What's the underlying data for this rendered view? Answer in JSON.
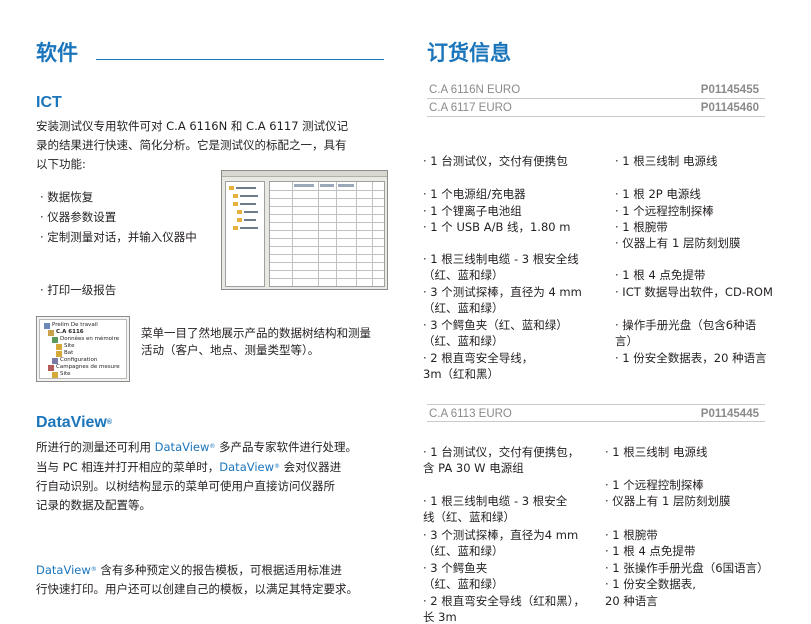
{
  "left": {
    "section_title": "软件",
    "ict_title": "ICT",
    "ict_para_lines": [
      "安装测试仪专用软件可对 C.A 6116N 和 C.A 6117 测试仪记",
      "录的结果进行快速、简化分析。它是测试仪的标配之一，具有",
      "以下功能:"
    ],
    "features": [
      "· 数据恢复",
      "· 仪器参数设置",
      "· 定制测量对话，并输入仪器中",
      "· 打印一级报告"
    ],
    "menu_caption_lines": [
      "菜单一目了然地展示产品的数据树结构和测量",
      "活动（客户、地点、测量类型等）。"
    ],
    "tree_items": [
      "Prelim De travail",
      "C.A 6116",
      "Données en mémoire",
      "Site",
      "Bat",
      "Configuration",
      "Campagnes de mesure",
      "Site"
    ],
    "dataview_title": "DataView",
    "dataview_mark": "®",
    "dv_para1": [
      {
        "pre": "所进行的测量还可利用 ",
        "dv": "DataView",
        "reg": "®",
        "post": " 多产品专家软件进行处理。"
      },
      {
        "pre": "当与 PC 相连并打开相应的菜单时，",
        "dv": "DataView",
        "reg": "®",
        "post": " 会对仪器进"
      },
      {
        "pre": "行自动识别。以树结构显示的菜单可使用户直接访问仪器所",
        "dv": "",
        "reg": "",
        "post": ""
      },
      {
        "pre": "记录的数据及配置等。",
        "dv": "",
        "reg": "",
        "post": ""
      }
    ],
    "dv_para2": [
      {
        "pre": "",
        "dv": "DataView",
        "reg": "®",
        "post": " 含有多种预定义的报告模板，可根据适用标准进"
      },
      {
        "pre": "行快速打印。用户还可以创建自己的模板，以满足其特定要求。",
        "dv": "",
        "reg": "",
        "post": ""
      }
    ]
  },
  "right": {
    "section_title": "订货信息",
    "orders_a": [
      {
        "name": "C.A 6116N EURO",
        "code": "P01145455"
      },
      {
        "name": "C.A 6117 EURO",
        "code": "P01145460"
      }
    ],
    "block_a_col1": [
      "· 1 台测试仪，交付有便携包",
      "· 1 个电源组/充电器",
      "· 1 个锂离子电池组",
      "· 1 个 USB A/B 线，1.80 m",
      "· 1 根三线制电缆 - 3 根安全线",
      "   （红、蓝和绿）",
      "· 3 个测试探棒，直径为 4 mm",
      "   （红、蓝和绿）",
      "· 3 个鳄鱼夹（红、蓝和绿）",
      "   （红、蓝和绿）",
      "· 2 根直弯安全导线，",
      "   3m（红和黑）"
    ],
    "block_a_col2": [
      "· 1 根三线制 电源线",
      "· 1 根 2P 电源线",
      "· 1 个远程控制探棒",
      "· 1 根腕带",
      "· 仪器上有 1 层防刻划膜",
      "· 1 根 4 点免提带",
      "· ICT 数据导出软件，CD-ROM",
      "· 操作手册光盘（包含6种语",
      "   言）",
      "· 1 份安全数据表，20 种语言"
    ],
    "orders_b": [
      {
        "name": "C.A 6113 EURO",
        "code": "P01145445"
      }
    ],
    "block_b_col1": [
      "· 1 台测试仪，交付有便携包，",
      "   含 PA 30 W 电源组",
      "· 1 根三线制电缆 - 3 根安全",
      "   线（红、蓝和绿）",
      "· 3 个测试探棒，直径为4 mm",
      "   （红、蓝和绿）",
      "· 3 个鳄鱼夹",
      "   （红、蓝和绿）",
      "· 2 根直弯安全导线（红和黑），",
      "   长 3m"
    ],
    "block_b_col2": [
      "· 1 根三线制 电源线",
      "· 1 个远程控制探棒",
      "· 仪器上有 1 层防刻划膜",
      "· 1 根腕带",
      "· 1 根 4 点免提带",
      "· 1 张操作手册光盘（6国语言）",
      "· 1 份安全数据表,",
      "   20 种语言"
    ]
  },
  "colors": {
    "accent": "#1b75bb",
    "text": "#231f20",
    "muted": "#8a8a8a",
    "rule": "#c9c9c9"
  }
}
